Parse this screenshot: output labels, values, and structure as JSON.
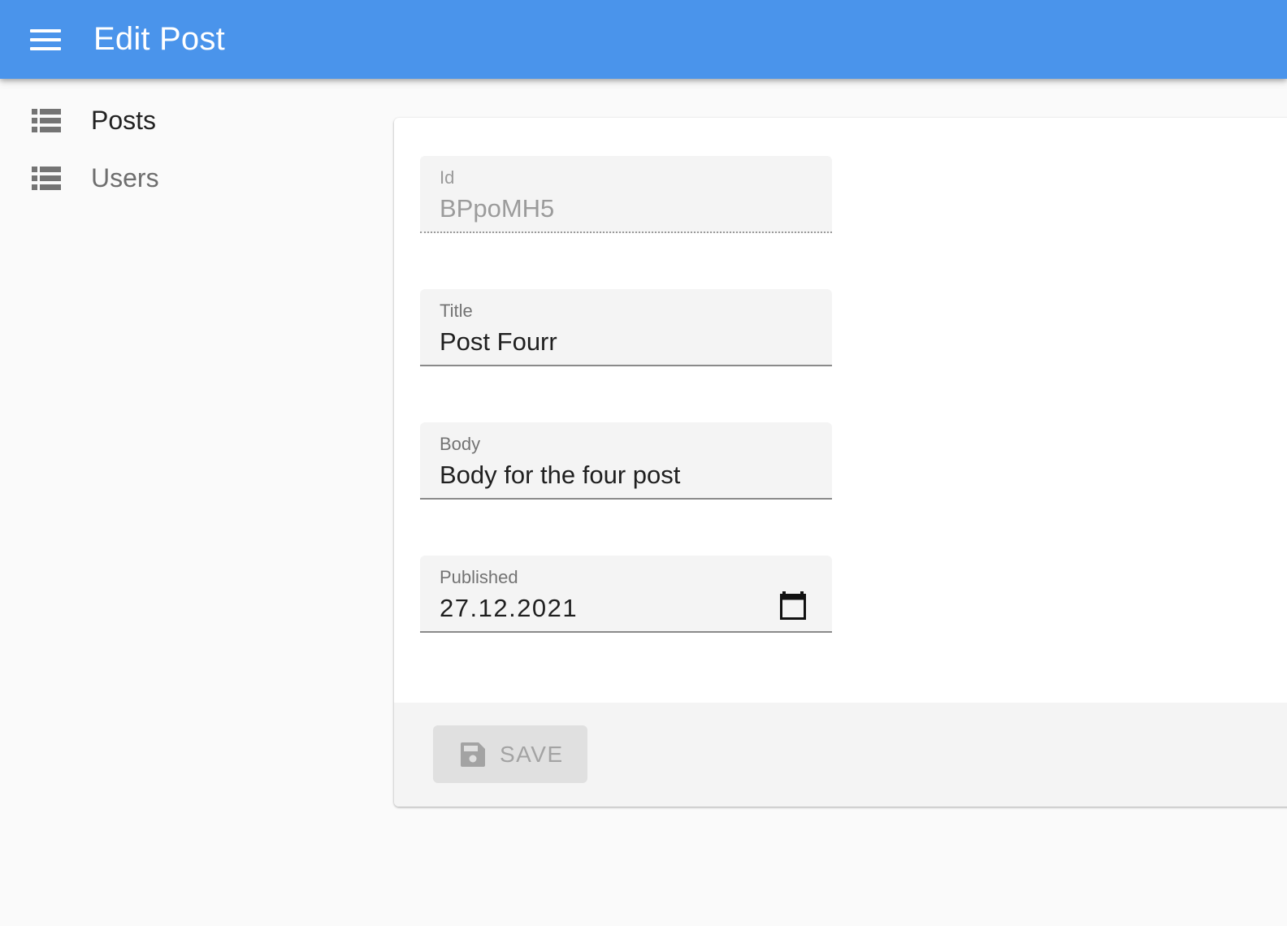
{
  "appbar": {
    "title": "Edit Post",
    "menu_icon": "hamburger-menu-icon",
    "color": "#4a94eb"
  },
  "sidebar": {
    "items": [
      {
        "label": "Posts",
        "icon": "list-icon"
      },
      {
        "label": "Users",
        "icon": "list-icon"
      }
    ]
  },
  "form": {
    "fields": [
      {
        "label": "Id",
        "value": "BPpoMH5",
        "disabled": true
      },
      {
        "label": "Title",
        "value": "Post Fourr"
      },
      {
        "label": "Body",
        "value": "Body for the four post"
      },
      {
        "label": "Published",
        "value": "27.12.2021",
        "icon": "calendar-icon"
      }
    ],
    "save_label": "SAVE",
    "save_icon": "floppy-disk-icon",
    "save_disabled": true
  }
}
